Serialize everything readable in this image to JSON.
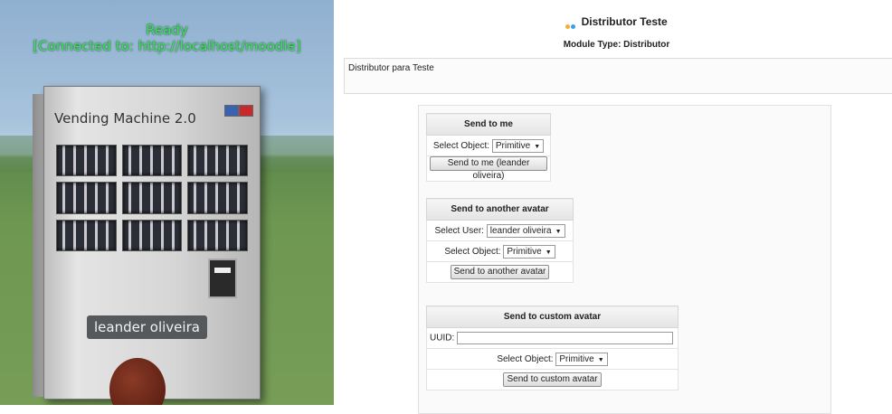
{
  "viewer": {
    "status_line1": "Ready",
    "status_line2": "[Connected to: http://localhost/moodle]",
    "machine_title": "Vending Machine 2.0",
    "avatar_name": "leander oliveira"
  },
  "page": {
    "title": "Distributor Teste",
    "module_type": "Module Type: Distributor",
    "description": "Distributor para Teste"
  },
  "send_to_me": {
    "header": "Send to me",
    "object_label": "Select Object:",
    "object_value": "Primitive",
    "button": "Send to me (leander oliveira)"
  },
  "send_to_avatar": {
    "header": "Send to another avatar",
    "user_label": "Select User:",
    "user_value": "leander oliveira",
    "object_label": "Select Object:",
    "object_value": "Primitive",
    "button": "Send to another avatar"
  },
  "send_to_custom": {
    "header": "Send to custom avatar",
    "uuid_label": "UUID:",
    "uuid_value": "",
    "object_label": "Select Object:",
    "object_value": "Primitive",
    "button": "Send to custom avatar"
  },
  "colors": {
    "status_text": "#39e05a",
    "icon_dot1": "#f0b030",
    "icon_dot2": "#3aa0e0"
  }
}
